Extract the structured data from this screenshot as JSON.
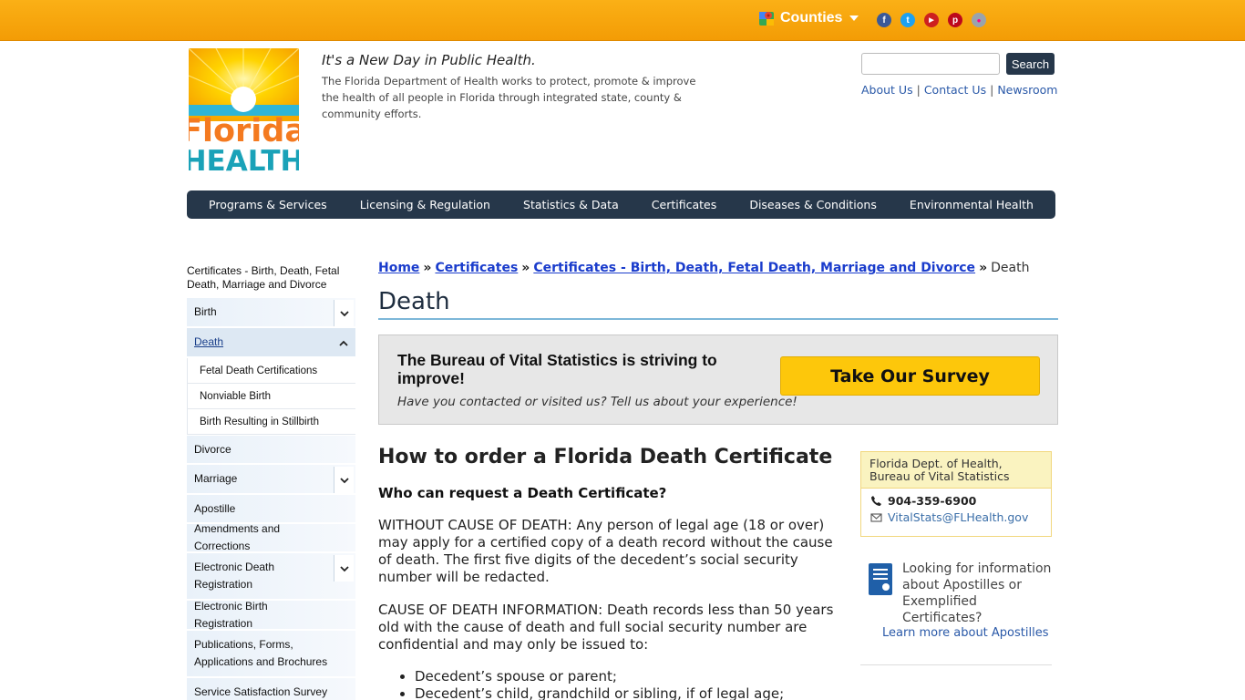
{
  "topbar": {
    "counties_label": "Counties",
    "social": [
      {
        "name": "facebook",
        "glyph": "f",
        "color": "#3b5998"
      },
      {
        "name": "twitter",
        "glyph": "t",
        "color": "#1da1f2"
      },
      {
        "name": "youtube",
        "glyph": "▶",
        "color": "#cd201f"
      },
      {
        "name": "pinterest",
        "glyph": "p",
        "color": "#bd081c"
      },
      {
        "name": "flickr",
        "glyph": "●",
        "color": "#9aa3ad"
      }
    ]
  },
  "header": {
    "logo_line1": "Florida",
    "logo_line2": "HEALTH",
    "tagline": "It's a New Day in Public Health.",
    "mission": "The Florida Department of Health works to protect, promote & improve the health of all people in Florida through integrated state, county & community efforts.",
    "search_button": "Search",
    "search_value": "",
    "links": [
      "About Us",
      "Contact Us",
      "Newsroom"
    ]
  },
  "nav": [
    "Programs & Services",
    "Licensing & Regulation",
    "Statistics & Data",
    "Certificates",
    "Diseases & Conditions",
    "Environmental Health"
  ],
  "sidebar": {
    "title": "Certificates - Birth, Death, Fetal Death, Marriage and Divorce",
    "items": {
      "birth": "Birth",
      "death": "Death",
      "fetal": "Fetal Death Certifications",
      "nonviable": "Nonviable Birth",
      "stillbirth": "Birth Resulting in Stillbirth",
      "divorce": "Divorce",
      "marriage": "Marriage",
      "apostille": "Apostille",
      "amend": "Amendments and Corrections",
      "edr": "Electronic Death Registration",
      "ebr": "Electronic Birth Registration",
      "pubs": "Publications, Forms, Applications and Brochures",
      "sss": "Service Satisfaction Survey"
    }
  },
  "breadcrumb": {
    "home": "Home",
    "certificates": "Certificates",
    "section": "Certificates - Birth, Death, Fetal Death, Marriage and Divorce",
    "current": "Death",
    "sep": "»"
  },
  "page": {
    "title": "Death",
    "survey_heading": "The Bureau of Vital Statistics is striving to improve!",
    "survey_sub": "Have you contacted or visited us? Tell us about your experience!",
    "survey_button": "Take Our Survey",
    "h2": "How to order a Florida Death Certificate",
    "h3": "Who can request a Death Certificate?",
    "p1": "WITHOUT CAUSE OF DEATH: Any person of legal age (18 or over) may apply for a certified copy of a death record without the cause of death. The first five digits of the decedent’s social security number will be redacted.",
    "p2": "CAUSE OF DEATH INFORMATION:  Death records less than 50 years old with the cause of death and full social security number are confidential and may only be issued to:",
    "bullets": [
      "Decedent’s spouse or parent;",
      "Decedent’s child, grandchild or sibling, if of legal age;"
    ]
  },
  "contact": {
    "heading": "Florida Dept. of Health, Bureau of Vital Statistics",
    "phone": "904-359-6900",
    "email": "VitalStats@FLHealth.gov"
  },
  "apostille": {
    "text": "Looking for information about Apostilles or Exemplified Certificates?",
    "link": "Learn more about Apostilles"
  }
}
